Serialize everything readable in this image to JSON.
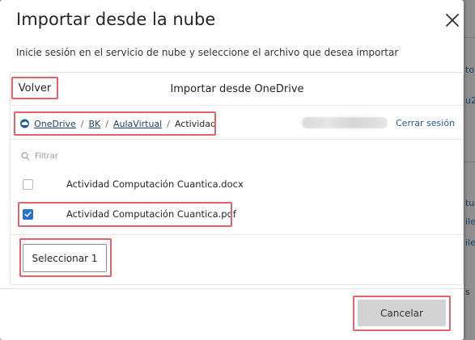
{
  "dialog": {
    "title": "Importar desde la nube",
    "subtitle": "Inicie sesión en el servicio de nube y seleccione el archivo que desea importar",
    "close_icon": "close-icon"
  },
  "panel": {
    "back_label": "Volver",
    "title": "Importar desde OneDrive",
    "breadcrumb": {
      "items": [
        "OneDrive",
        "BK",
        "AulaVirtual"
      ],
      "separator": "/",
      "current": "Actividad"
    },
    "sign_out_label": "Cerrar sesión",
    "filter_placeholder": "Filtrar",
    "files": [
      {
        "name": "Actividad Computación Cuantica.docx",
        "checked": false
      },
      {
        "name": "Actividad Computación Cuantica.pdf",
        "checked": true
      }
    ],
    "select_button_label": "Seleccionar 1"
  },
  "footer": {
    "cancel_label": "Cancelar"
  },
  "background": {
    "fragments": [
      "to",
      "u2",
      "tu",
      "ile",
      "ile",
      "s"
    ]
  },
  "colors": {
    "highlight": "#e0646a",
    "link": "#1f3f66",
    "checkbox_accent": "#2b6fcf",
    "cancel_bg": "#d3d3d3"
  }
}
